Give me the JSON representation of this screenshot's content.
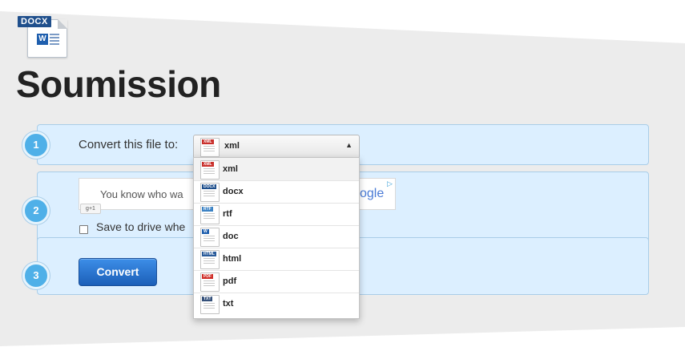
{
  "header": {
    "badge": "DOCX",
    "badge_letter": "W",
    "title": "Soumission"
  },
  "steps": [
    {
      "number": "1",
      "label": "Convert this file to:"
    },
    {
      "number": "2"
    },
    {
      "number": "3"
    }
  ],
  "format_select": {
    "selected": "xml",
    "options": [
      {
        "label": "xml",
        "icon": "xml-file-icon",
        "badge": "XML",
        "color": "#c9302c"
      },
      {
        "label": "docx",
        "icon": "docx-file-icon",
        "badge": "DOCX",
        "color": "#1f4f8c"
      },
      {
        "label": "rtf",
        "icon": "rtf-file-icon",
        "badge": "RTF",
        "color": "#3b82c4"
      },
      {
        "label": "doc",
        "icon": "doc-file-icon",
        "badge": "W",
        "color": "#1f5fae"
      },
      {
        "label": "html",
        "icon": "html-file-icon",
        "badge": "HTML",
        "color": "#2a5b9a"
      },
      {
        "label": "pdf",
        "icon": "pdf-file-icon",
        "badge": "PDF",
        "color": "#d0302a"
      },
      {
        "label": "txt",
        "icon": "txt-file-icon",
        "badge": "TXT",
        "color": "#34507a"
      }
    ]
  },
  "ad": {
    "text": "You know who wa",
    "google_fragment": "ogle",
    "gplus": "+1"
  },
  "save_option": {
    "label": "Save to drive whe",
    "checked": false
  },
  "actions": {
    "convert_label": "Convert"
  },
  "colors": {
    "step_bg": "#dcefff",
    "step_border": "#a9cde8",
    "step_number": "#4fb0e8",
    "button": "#1c5fb8",
    "panel": "#ececec"
  }
}
